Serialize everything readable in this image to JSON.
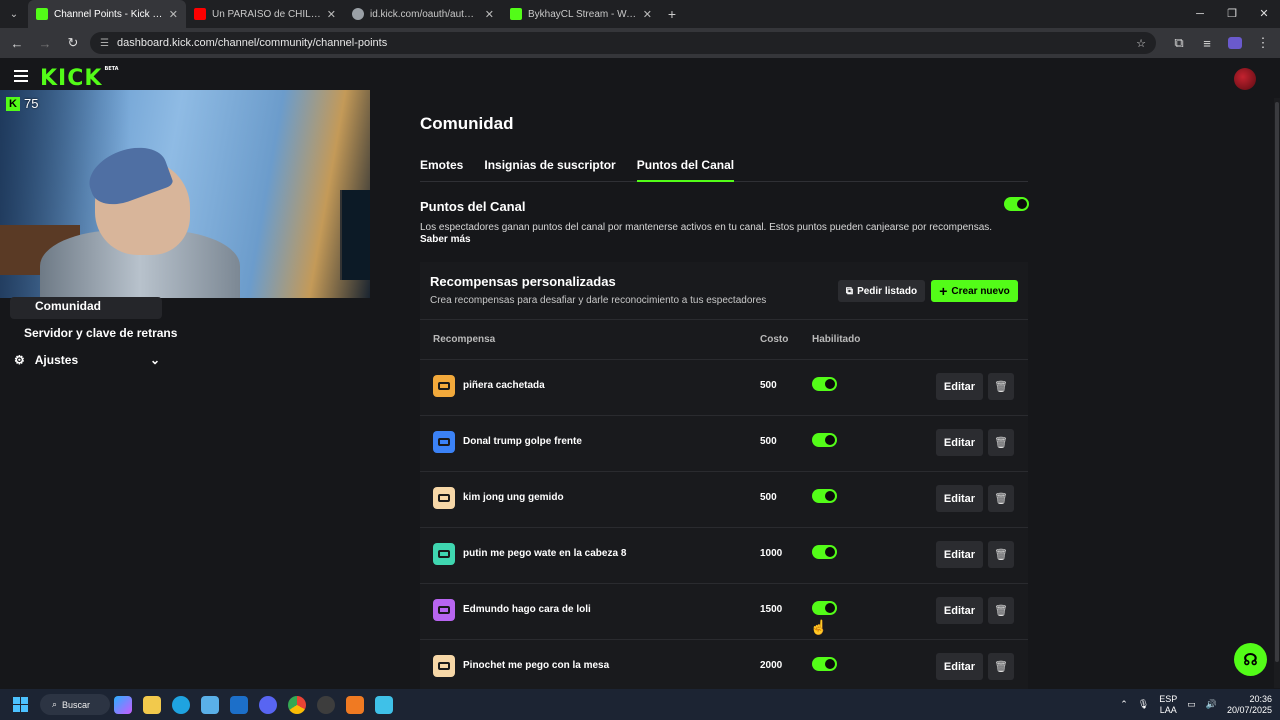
{
  "browser": {
    "tabs": [
      {
        "title": "Channel Points - Kick Dashboard",
        "favicon_color": "#53fc18",
        "active": true
      },
      {
        "title": "Un PARAÍSO de CHILENAS! ASÍ",
        "favicon_color": "#ff0000",
        "active": false
      },
      {
        "title": "id.kick.com/oauth/authorize?re",
        "favicon_color": "#9aa0a6",
        "active": false
      },
      {
        "title": "BykhayCL Stream - Watch Live o",
        "favicon_color": "#53fc18",
        "active": false
      }
    ],
    "url": "dashboard.kick.com/channel/community/channel-points"
  },
  "header": {
    "logo": "KICK",
    "logo_tag": "BETA"
  },
  "stream_overlay": {
    "kick_badge": "K",
    "viewers": "75"
  },
  "sidebar": {
    "items": [
      {
        "label": "Comunidad",
        "active": true
      },
      {
        "label": "Servidor y clave de retrans"
      },
      {
        "label": "Ajustes"
      }
    ]
  },
  "main": {
    "title": "Comunidad",
    "tabs": [
      {
        "label": "Emotes"
      },
      {
        "label": "Insignias de suscriptor"
      },
      {
        "label": "Puntos del Canal",
        "active": true
      }
    ],
    "section": {
      "title": "Puntos del Canal",
      "description": "Los espectadores ganan puntos del canal por mantenerse activos en tu canal. Estos puntos pueden canjearse por recompensas.",
      "learn_more": "Saber más"
    },
    "rewards": {
      "title": "Recompensas personalizadas",
      "subtitle": "Crea recompensas para desafiar y darle reconocimiento a tus espectadores",
      "pedir_label": "Pedir listado",
      "crear_label": "Crear nuevo",
      "columns": {
        "reward": "Recompensa",
        "cost": "Costo",
        "enabled": "Habilitado"
      },
      "edit_label": "Editar",
      "rows": [
        {
          "name": "piñera cachetada",
          "cost": "500",
          "color": "#f2a93b"
        },
        {
          "name": "Donal trump golpe frente",
          "cost": "500",
          "color": "#3b82f6"
        },
        {
          "name": "kim jong ung gemido",
          "cost": "500",
          "color": "#f6d7a7"
        },
        {
          "name": "putin me pego wate en la cabeza 8",
          "cost": "1000",
          "color": "#3fd6b0"
        },
        {
          "name": "Edmundo hago cara de loli",
          "cost": "1500",
          "color": "#b865f0"
        },
        {
          "name": "Pinochet me pego con la mesa",
          "cost": "2000",
          "color": "#f6d7a7"
        }
      ]
    }
  },
  "taskbar": {
    "search_label": "Buscar",
    "lang_line1": "ESP",
    "lang_line2": "LAA",
    "time": "20:36",
    "date": "20/07/2025"
  },
  "colors": {
    "accent": "#53fc18",
    "background": "#16171a",
    "panel": "#191a1d"
  }
}
